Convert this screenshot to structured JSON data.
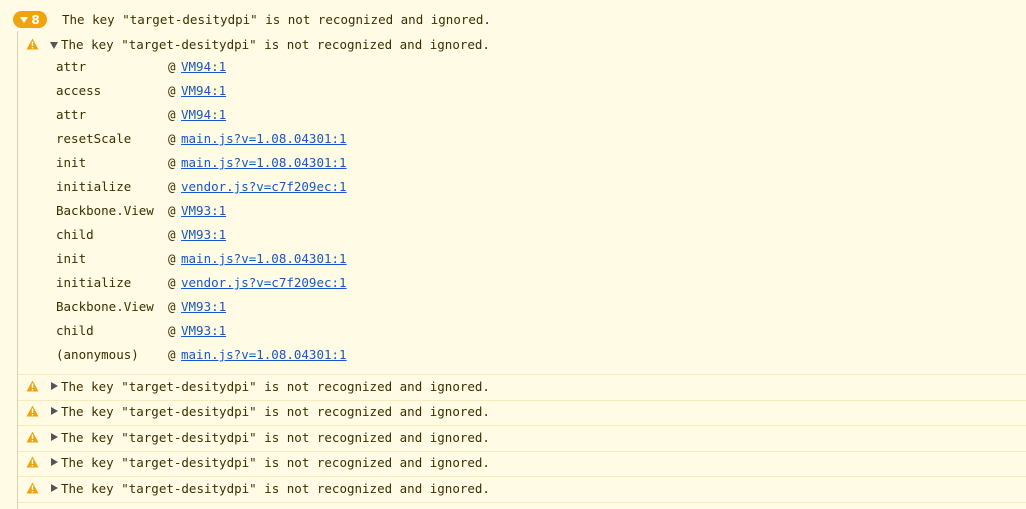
{
  "group": {
    "count": "8",
    "message": "The key \"target-desitydpi\" is not recognized and ignored."
  },
  "expanded_entry": {
    "message": "The key \"target-desitydpi\" is not recognized and ignored.",
    "stack": [
      {
        "fn": "attr",
        "at": "@",
        "link": "VM94:1"
      },
      {
        "fn": "access",
        "at": "@",
        "link": "VM94:1"
      },
      {
        "fn": "attr",
        "at": "@",
        "link": "VM94:1"
      },
      {
        "fn": "resetScale",
        "at": "@",
        "link": "main.js?v=1.08.04301:1"
      },
      {
        "fn": "init",
        "at": "@",
        "link": "main.js?v=1.08.04301:1"
      },
      {
        "fn": "initialize",
        "at": "@",
        "link": "vendor.js?v=c7f209ec:1"
      },
      {
        "fn": "Backbone.View",
        "at": "@",
        "link": "VM93:1"
      },
      {
        "fn": "child",
        "at": "@",
        "link": "VM93:1"
      },
      {
        "fn": "init",
        "at": "@",
        "link": "main.js?v=1.08.04301:1"
      },
      {
        "fn": "initialize",
        "at": "@",
        "link": "vendor.js?v=c7f209ec:1"
      },
      {
        "fn": "Backbone.View",
        "at": "@",
        "link": "VM93:1"
      },
      {
        "fn": "child",
        "at": "@",
        "link": "VM93:1"
      },
      {
        "fn": "(anonymous)",
        "at": "@",
        "link": "main.js?v=1.08.04301:1"
      }
    ]
  },
  "collapsed_entries": [
    {
      "message": "The key \"target-desitydpi\" is not recognized and ignored."
    },
    {
      "message": "The key \"target-desitydpi\" is not recognized and ignored."
    },
    {
      "message": "The key \"target-desitydpi\" is not recognized and ignored."
    },
    {
      "message": "The key \"target-desitydpi\" is not recognized and ignored."
    },
    {
      "message": "The key \"target-desitydpi\" is not recognized and ignored."
    }
  ],
  "colors": {
    "background": "#fffbe5",
    "badge": "#f0a30a",
    "warning_icon": "#f0a30a",
    "link": "#1a56c4",
    "text": "#3b2f00"
  },
  "icons": {
    "warning": "warning-icon",
    "disclosure_open": "triangle-down-icon",
    "disclosure_closed": "triangle-right-icon"
  }
}
